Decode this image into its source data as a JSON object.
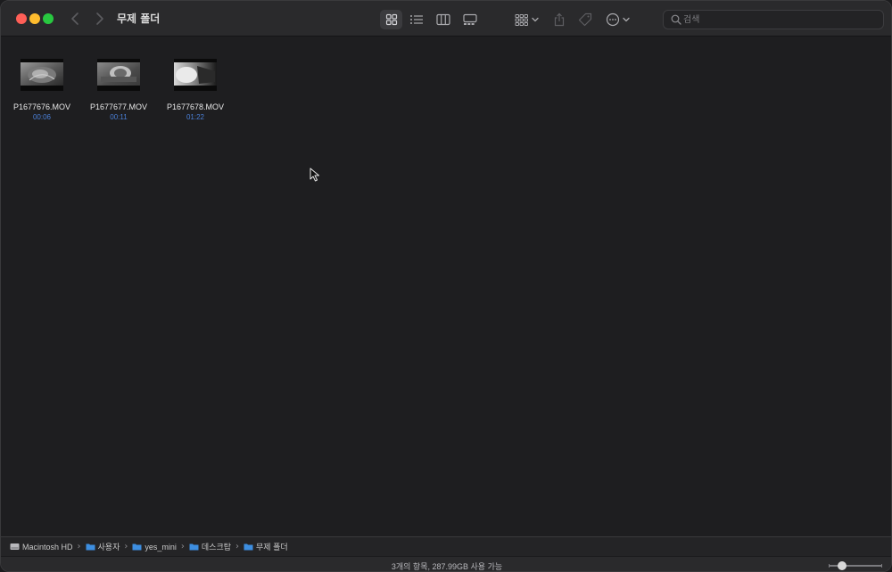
{
  "window": {
    "title": "무제 폴더"
  },
  "toolbar": {
    "views": [
      {
        "name": "icon-view",
        "icon": "grid-icon",
        "active": true
      },
      {
        "name": "list-view",
        "icon": "list-icon",
        "active": false
      },
      {
        "name": "column-view",
        "icon": "columns-icon",
        "active": false
      },
      {
        "name": "gallery-view",
        "icon": "gallery-icon",
        "active": false
      }
    ],
    "search": {
      "placeholder": "검색",
      "value": ""
    }
  },
  "files": [
    {
      "name": "P1677676.MOV",
      "duration": "00:06"
    },
    {
      "name": "P1677677.MOV",
      "duration": "00:11"
    },
    {
      "name": "P1677678.MOV",
      "duration": "01:22"
    }
  ],
  "pathbar": {
    "items": [
      {
        "label": "Macintosh HD",
        "icon": "disk-icon"
      },
      {
        "label": "사용자",
        "icon": "folder-icon"
      },
      {
        "label": "yes_mini",
        "icon": "folder-icon"
      },
      {
        "label": "데스크탑",
        "icon": "folder-icon"
      },
      {
        "label": "무제 폴더",
        "icon": "folder-icon"
      }
    ]
  },
  "status": {
    "text": "3개의 항목, 287.99GB 사용 가능"
  },
  "colors": {
    "accent": "#4a7fd6",
    "folder": "#3d8ee0"
  }
}
